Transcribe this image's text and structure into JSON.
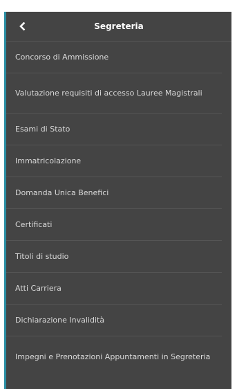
{
  "header": {
    "back_label": "<",
    "title": "Segreteria"
  },
  "menu": {
    "items": [
      {
        "label": "Concorso di Ammissione"
      },
      {
        "label": "Valutazione requisiti di accesso Lauree Magistrali"
      },
      {
        "label": "Esami di Stato"
      },
      {
        "label": "Immatricolazione"
      },
      {
        "label": "Domanda Unica Benefici"
      },
      {
        "label": "Certificati"
      },
      {
        "label": "Titoli di studio"
      },
      {
        "label": "Atti Carriera"
      },
      {
        "label": "Dichiarazione Invalidità"
      },
      {
        "label": "Impegni e Prenotazioni Appuntamenti in Segreteria"
      }
    ]
  },
  "colors": {
    "panel_bg": "#444444",
    "accent": "#2a8ea3",
    "text": "#d9d9d9",
    "title": "#ffffff",
    "divider": "#555555"
  },
  "icons": {
    "back": "chevron-left-icon"
  }
}
